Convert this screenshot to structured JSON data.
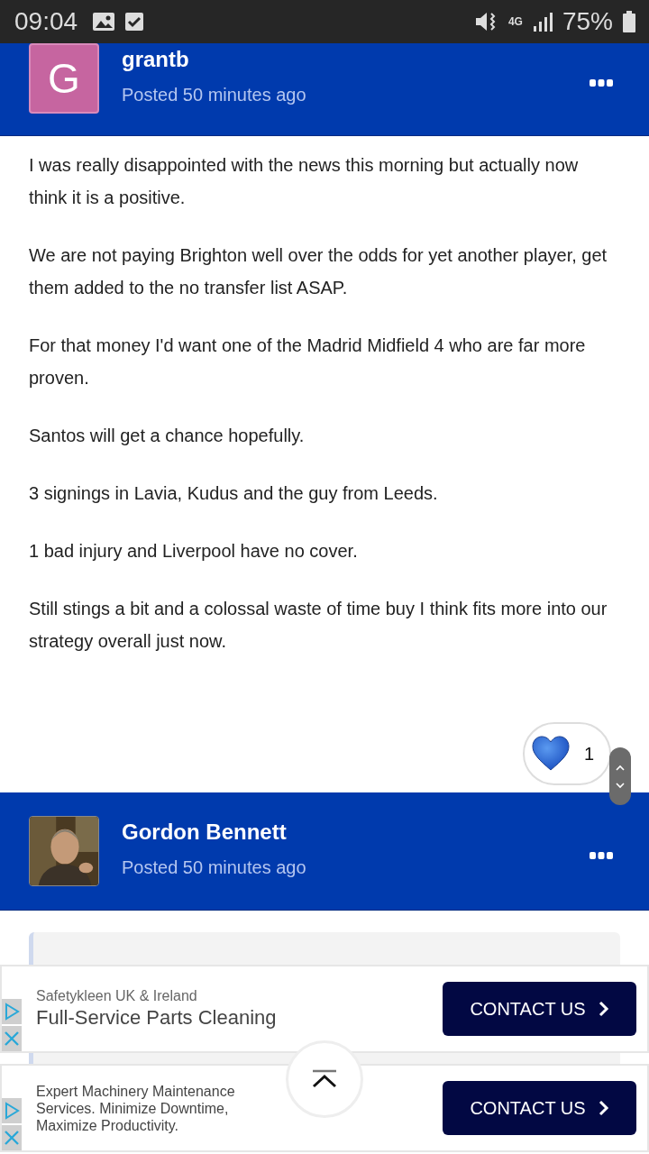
{
  "status_bar": {
    "time": "09:04",
    "battery": "75%",
    "network": "4G"
  },
  "posts": [
    {
      "author": "grantb",
      "posted": "Posted 50 minutes ago",
      "avatar": {
        "kind": "letter",
        "letter": "G"
      },
      "paragraphs": [
        "I was really disappointed with the news this morning but actually now think it is a positive.",
        "We are not paying Brighton well over the odds for yet another player, get them added to the no transfer list ASAP.",
        "For that money I'd want one of the Madrid Midfield 4 who are far more proven.",
        "Santos will get a chance hopefully.",
        "3 signings in Lavia, Kudus and the guy from Leeds.",
        "1 bad injury and Liverpool have no cover.",
        "Still stings a bit and a colossal waste of time buy I think fits more into our strategy overall just now."
      ],
      "reactions": {
        "count": "1"
      }
    },
    {
      "author": "Gordon Bennett",
      "posted": "Posted 50 minutes ago",
      "quote": true
    }
  ],
  "ads": [
    {
      "advertiser": "Safetykleen UK & Ireland",
      "headline": "Full-Service Parts Cleaning",
      "button": "CONTACT US"
    },
    {
      "headline": "Expert Machinery Maintenance Services. Minimize Downtime, Maximize Productivity.",
      "button": "CONTACT US"
    }
  ]
}
